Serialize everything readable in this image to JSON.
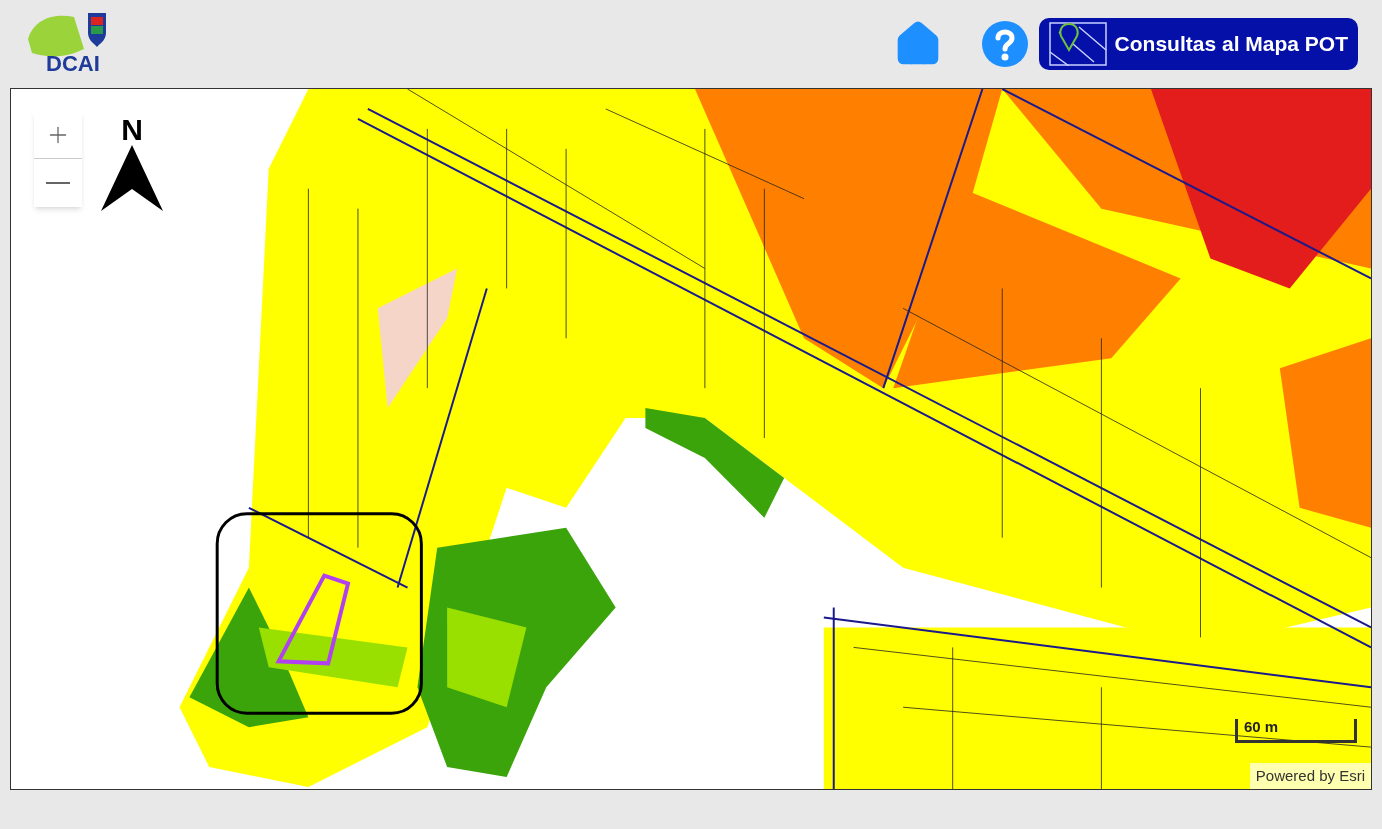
{
  "header": {
    "logo_text": "DCAI",
    "query_button": "Consultas al Mapa POT"
  },
  "map": {
    "north_label": "N",
    "scale_label": "60 m",
    "attribution": "Powered by Esri"
  }
}
